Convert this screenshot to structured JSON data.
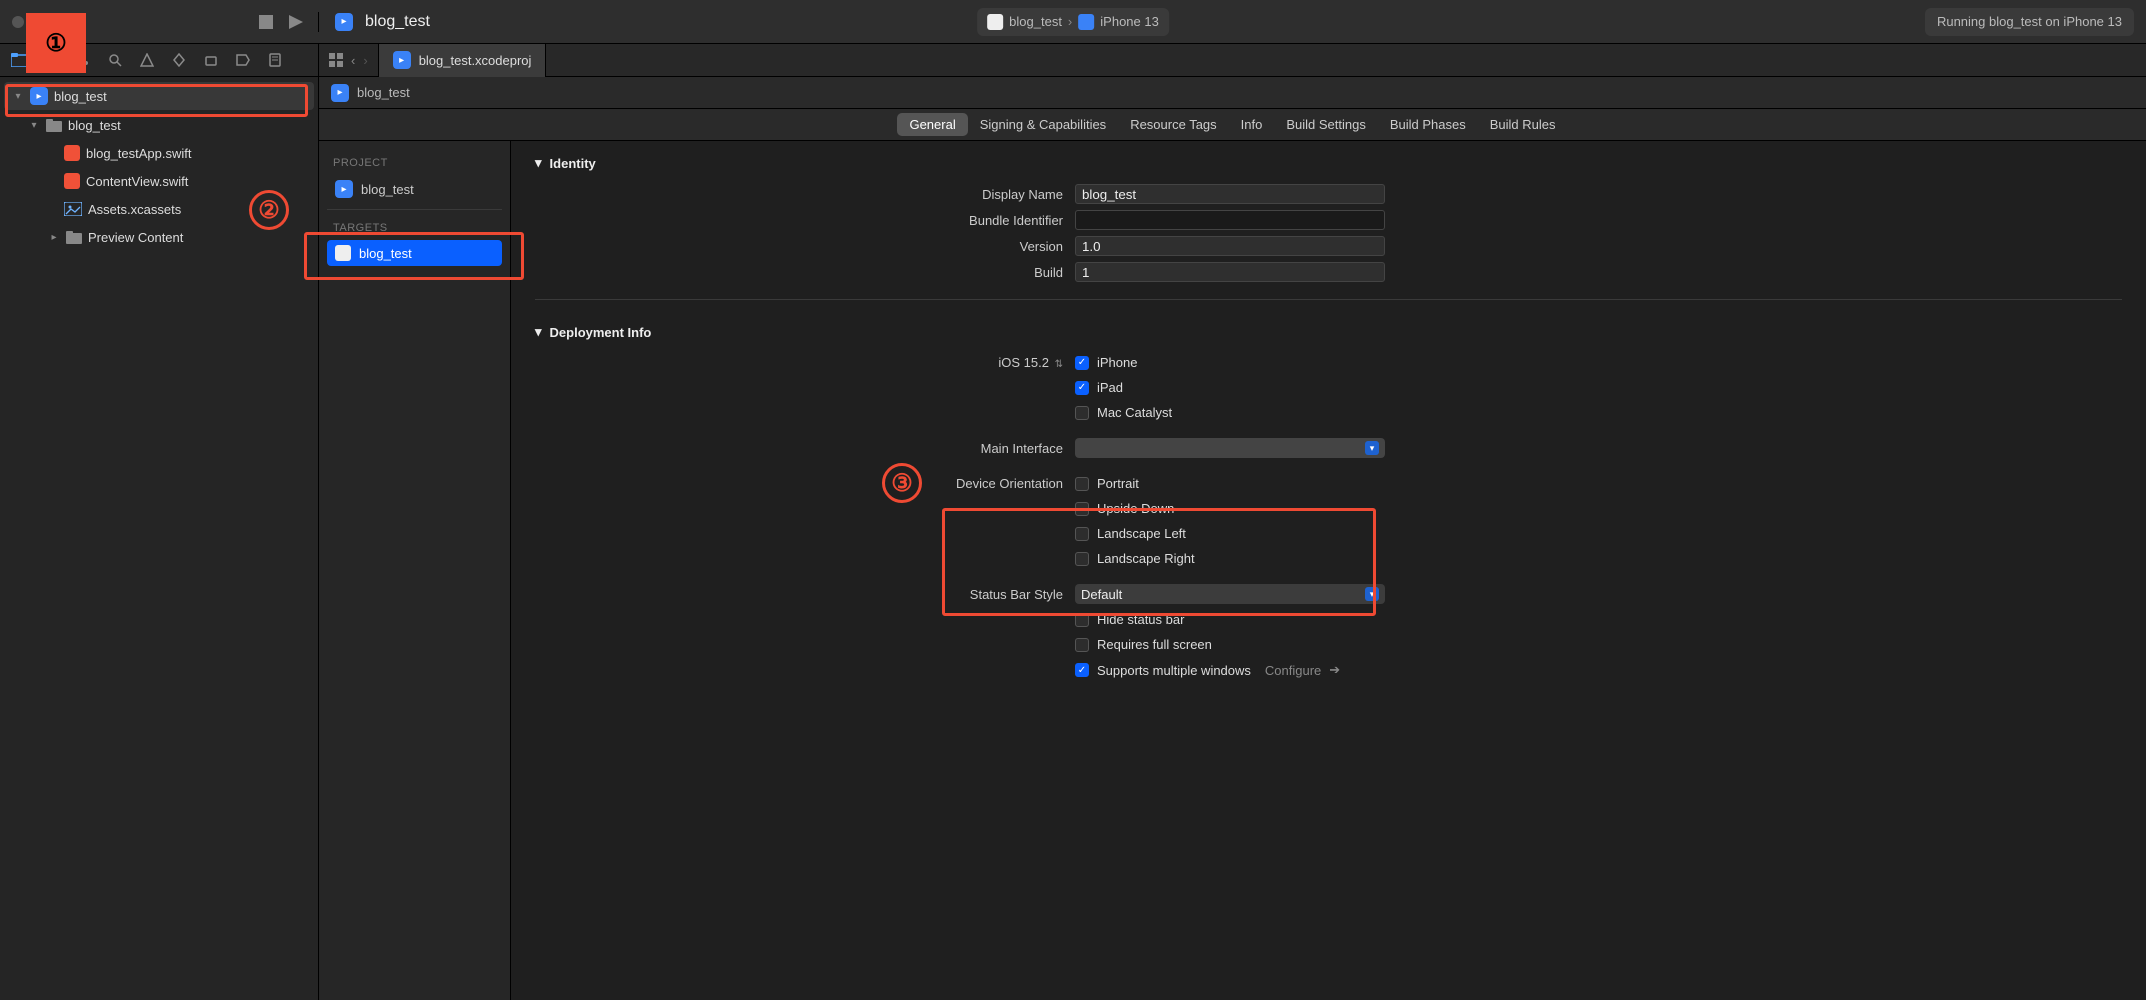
{
  "toolbar": {
    "project_title": "blog_test",
    "scheme_project": "blog_test",
    "scheme_device": "iPhone 13",
    "status": "Running blog_test on iPhone 13"
  },
  "tabs": {
    "file_tab": "blog_test.xcodeproj",
    "breadcrumb": "blog_test"
  },
  "sidebar": {
    "root": "blog_test",
    "group": "blog_test",
    "items": [
      "blog_testApp.swift",
      "ContentView.swift",
      "Assets.xcassets",
      "Preview Content"
    ]
  },
  "projectPanel": {
    "project_hdr": "PROJECT",
    "project_item": "blog_test",
    "targets_hdr": "TARGETS",
    "target_item": "blog_test"
  },
  "configTabs": [
    "General",
    "Signing & Capabilities",
    "Resource Tags",
    "Info",
    "Build Settings",
    "Build Phases",
    "Build Rules"
  ],
  "identity": {
    "section": "Identity",
    "display_name_lbl": "Display Name",
    "display_name": "blog_test",
    "bundle_id_lbl": "Bundle Identifier",
    "bundle_id": "",
    "version_lbl": "Version",
    "version": "1.0",
    "build_lbl": "Build",
    "build": "1"
  },
  "deployment": {
    "section": "Deployment Info",
    "target_lbl": "iOS 15.2",
    "devices": [
      "iPhone",
      "iPad",
      "Mac Catalyst"
    ],
    "devices_checked": [
      true,
      true,
      false
    ],
    "main_if_lbl": "Main Interface",
    "main_if": "",
    "orient_lbl": "Device Orientation",
    "orients": [
      "Portrait",
      "Upside Down",
      "Landscape Left",
      "Landscape Right"
    ],
    "orients_checked": [
      false,
      false,
      false,
      false
    ],
    "status_bar_lbl": "Status Bar Style",
    "status_bar": "Default",
    "hide_sb": "Hide status bar",
    "req_fs": "Requires full screen",
    "multi_win": "Supports multiple windows",
    "configure": "Configure"
  },
  "annotations": {
    "n1": "①",
    "n2": "②",
    "n3": "③"
  }
}
